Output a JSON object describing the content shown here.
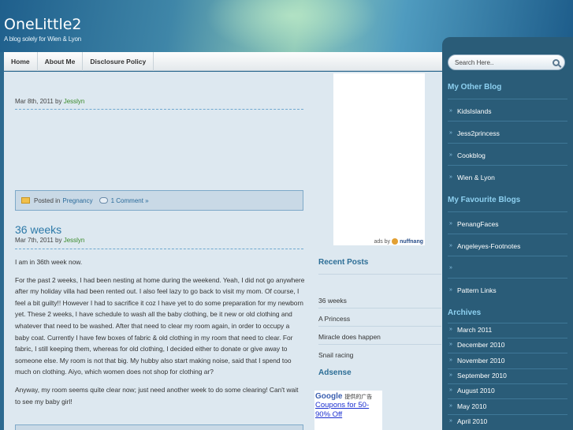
{
  "site": {
    "title": "OneLittle2",
    "tagline": "A blog solely for Wien & Lyon"
  },
  "nav": {
    "items": [
      "Home",
      "About Me",
      "Disclosure Policy"
    ]
  },
  "post1": {
    "date": "Mar 8th, 2011",
    "by": "by",
    "author": "Jesslyn",
    "posted_in": "Posted in",
    "category": "Pregnancy",
    "comments": "1 Comment »"
  },
  "post2": {
    "title": "36 weeks",
    "date": "Mar 7th, 2011",
    "by": "by",
    "author": "Jesslyn",
    "paragraphs": [
      "I am in 36th week now.",
      "For the past 2 weeks, I had been nesting at home during the weekend. Yeah, I did not go anywhere after my holiday villa had been rented out. I also feel lazy to go back to visit my mom. Of course, I feel a bit guilty!! However I had to sacrifice it coz I have yet to do some preparation for my newborn yet. These 2 weeks, I have schedule to wash all the baby clothing, be it new or old clothing and whatever that need to be washed. After that need to clear my room again, in order to occupy a baby coat. Currently I have few boxes of fabric & old clothing in my room that need to clear. For fabric, I still keeping them, whereas for old clothing, I decided either to donate or give away to someone else. My room is not that big. My hubby also start making noise, said that I spend too much on clothing. Aiyo, which women does not shop for clothing ar?",
      "Anyway, my room seems quite clear now; just need another week to do some clearing! Can't wait to see my baby girl!"
    ]
  },
  "ad": {
    "ads_by": "ads by",
    "brand": "nuffnang"
  },
  "recent_posts": {
    "heading": "Recent Posts",
    "items": [
      "36 weeks",
      "A Princess",
      "Miracle does happen",
      "Snail racing"
    ]
  },
  "adsense": {
    "heading": "Adsense",
    "google": "Google",
    "google_suffix": "提供的广告",
    "link1": "Coupons for 50-",
    "link2": "90% Off"
  },
  "sidebar": {
    "search_placeholder": "Search Here..",
    "other_blog_heading": "My Other Blog",
    "other_blogs": [
      "KidsIslands",
      "Jess2princess",
      "Cookblog",
      "Wien & Lyon"
    ],
    "favourite_heading": "My Favourite Blogs",
    "favourites": [
      "PenangFaces",
      "Angeleyes-Footnotes",
      "",
      "Pattern Links"
    ],
    "archives_heading": "Archives",
    "archives": [
      "March 2011",
      "December 2010",
      "November 2010",
      "September 2010",
      "August 2010",
      "May 2010",
      "April 2010"
    ]
  }
}
